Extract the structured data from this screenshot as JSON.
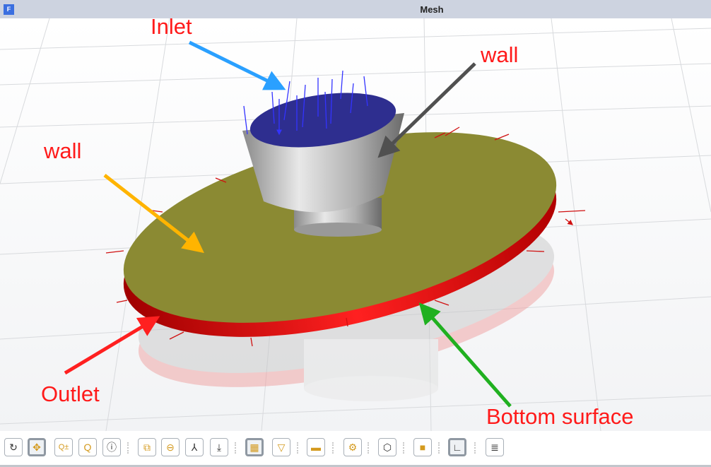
{
  "window": {
    "title": "Mesh",
    "app_icon_letter": "F"
  },
  "annotations": {
    "inlet": "Inlet",
    "wall_top": "wall",
    "wall_left": "wall",
    "outlet": "Outlet",
    "bottom_surface": "Bottom surface"
  },
  "colors": {
    "label": "#ff1a1a",
    "disc_top": "#8b8a33",
    "disc_edge": "#e01010",
    "inlet_face": "#2e2e8f",
    "inlet_arrow": "#3333ff",
    "outlet_arrow": "#e02020"
  },
  "toolbar": {
    "buttons": [
      {
        "name": "rotate",
        "icon": "↻"
      },
      {
        "name": "pan",
        "icon": "✥",
        "active": true
      },
      {
        "name": "zoom-in-out",
        "icon": "Q±"
      },
      {
        "name": "zoom",
        "icon": "Q"
      },
      {
        "name": "info",
        "icon": "ⓘ"
      },
      {
        "name": "zoom-box",
        "icon": "⧉"
      },
      {
        "name": "zoom-fit",
        "icon": "⊖"
      },
      {
        "name": "axes",
        "icon": "⅄"
      },
      {
        "name": "export",
        "icon": "⤓"
      },
      {
        "name": "mesh-display",
        "icon": "▦",
        "active": true
      },
      {
        "name": "filter",
        "icon": "▽"
      },
      {
        "name": "transparency",
        "icon": "▬"
      },
      {
        "name": "lighting",
        "icon": "⚙"
      },
      {
        "name": "cube-view",
        "icon": "⬡"
      },
      {
        "name": "solid-view",
        "icon": "■"
      },
      {
        "name": "axis-triad",
        "icon": "∟",
        "active": true
      },
      {
        "name": "report",
        "icon": "≣"
      }
    ]
  }
}
